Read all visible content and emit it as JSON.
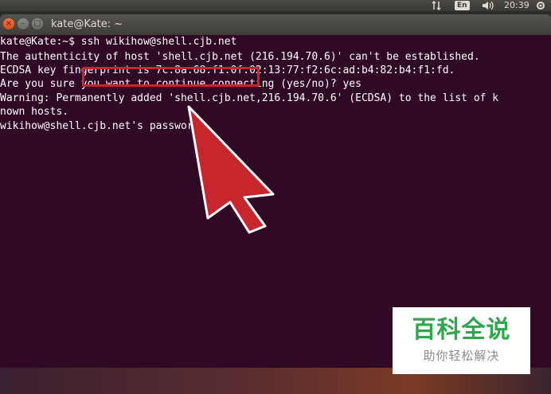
{
  "panel": {
    "network_icon": "network-arrows-icon",
    "language": "En",
    "volume_icon": "speaker-icon",
    "clock": "20:39",
    "settings_icon": "gear-icon"
  },
  "window": {
    "title": "kate@Kate: ~",
    "buttons": {
      "close": "×",
      "minimize": "–",
      "maximize": "□"
    }
  },
  "terminal": {
    "background": "#300a24",
    "lines": [
      "kate@Kate:~$ ssh wikihow@shell.cjb.net",
      "The authenticity of host 'shell.cjb.net (216.194.70.6)' can't be established.",
      "ECDSA key fingerprint is 7c:8a:68:f1:0f:02:13:77:f2:6c:ad:b4:82:b4:f1:fd.",
      "Are you sure you want to continue connecting (yes/no)? yes",
      "Warning: Permanently added 'shell.cjb.net,216.194.70.6' (ECDSA) to the list of k",
      "nown hosts.",
      "wikihow@shell.cjb.net's password:"
    ]
  },
  "annotation": {
    "highlight_color": "#c8262d",
    "arrow_icon": "red-pointer-arrow-icon"
  },
  "watermark": {
    "main": "百科全说",
    "sub": "助你轻松解决",
    "color": "#2ea84a"
  }
}
